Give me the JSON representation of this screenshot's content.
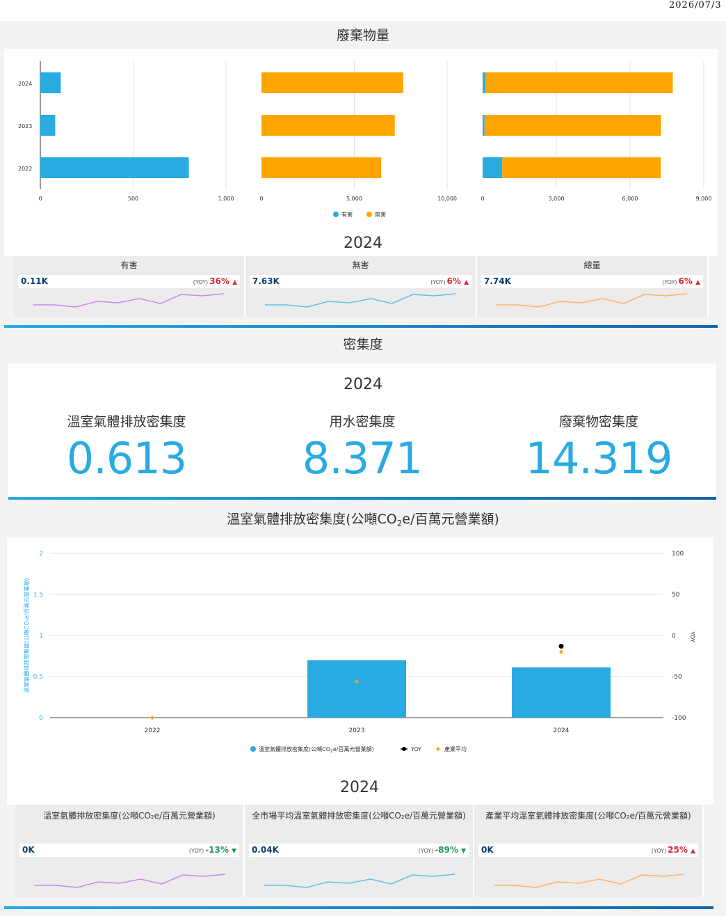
{
  "header": {
    "date": "2026/07/3"
  },
  "waste": {
    "title": "廢棄物量",
    "year": "2024",
    "legend": [
      {
        "name": "有害",
        "color": "#29abe2"
      },
      {
        "name": "無害",
        "color": "#ffa500"
      }
    ],
    "kpis": [
      {
        "title": "有害",
        "value": "0.11K",
        "yoy_label": "(YOY)",
        "yoy": "36%",
        "dir": "up",
        "arrow": "▲",
        "spark_color": "#c58af0"
      },
      {
        "title": "無害",
        "value": "7.63K",
        "yoy_label": "(YOY)",
        "yoy": "6%",
        "dir": "up",
        "arrow": "▲",
        "spark_color": "#5ec1ea"
      },
      {
        "title": "總量",
        "value": "7.74K",
        "yoy_label": "(YOY)",
        "yoy": "6%",
        "dir": "up",
        "arrow": "▲",
        "spark_color": "#ffb36b"
      }
    ]
  },
  "density": {
    "title": "密集度",
    "year": "2024",
    "items": [
      {
        "label": "溫室氣體排放密集度",
        "value": "0.613"
      },
      {
        "label": "用水密集度",
        "value": "8.371"
      },
      {
        "label": "廢棄物密集度",
        "value": "14.319"
      }
    ]
  },
  "ghg": {
    "title_pre": "溫室氣體排放密集度(公噸CO",
    "title_sub": "2",
    "title_post": "e/百萬元營業額)",
    "year": "2024",
    "legend": {
      "bar_pre": "溫室氣體排放密集度(公噸CO",
      "bar_sub": "2",
      "bar_post": "e/百萬元營業額)",
      "yoy": "YOY",
      "avg": "產業平均"
    },
    "kpis": [
      {
        "title": "溫室氣體排放密集度(公噸CO₂e/百萬元營業額)",
        "value": "0K",
        "yoy_label": "(YOY)",
        "yoy": "-13%",
        "dir": "down",
        "arrow": "▼",
        "spark_color": "#c58af0"
      },
      {
        "title": "全市場平均溫室氣體排放密集度(公噸CO₂e/百萬元營業額)",
        "value": "0.04K",
        "yoy_label": "(YOY)",
        "yoy": "-89%",
        "dir": "down",
        "arrow": "▼",
        "spark_color": "#5ec1ea"
      },
      {
        "title": "產業平均溫室氣體排放密集度(公噸CO₂e/百萬元營業額)",
        "value": "0K",
        "yoy_label": "(YOY)",
        "yoy": "25%",
        "dir": "up",
        "arrow": "▲",
        "spark_color": "#ffb36b"
      }
    ]
  },
  "colors": {
    "blue": "#29abe2",
    "orange": "#ffa500",
    "navy": "#0b3b6b",
    "up": "#d9262f",
    "down": "#21965a"
  },
  "chart_data": [
    {
      "type": "bar",
      "orientation": "horizontal",
      "name": "有害",
      "categories": [
        "2022",
        "2023",
        "2024"
      ],
      "values": [
        800,
        80,
        110
      ],
      "xlim": [
        0,
        1000
      ],
      "ticks": [
        "0",
        "500",
        "1,000"
      ],
      "color": "#29abe2"
    },
    {
      "type": "bar",
      "orientation": "horizontal",
      "name": "無害",
      "categories": [
        "2022",
        "2023",
        "2024"
      ],
      "values": [
        6450,
        7180,
        7630
      ],
      "xlim": [
        0,
        10000
      ],
      "ticks": [
        "0",
        "5,000",
        "10,000"
      ],
      "color": "#ffa500"
    },
    {
      "type": "bar",
      "orientation": "horizontal",
      "stacked": true,
      "categories": [
        "2022",
        "2023",
        "2024"
      ],
      "series": [
        {
          "name": "有害",
          "values": [
            800,
            80,
            110
          ],
          "color": "#29abe2"
        },
        {
          "name": "無害",
          "values": [
            6450,
            7180,
            7630
          ],
          "color": "#ffa500"
        }
      ],
      "xlim": [
        0,
        9000
      ],
      "ticks": [
        "0",
        "3,000",
        "6,000",
        "9,000"
      ]
    },
    {
      "type": "bar",
      "categories": [
        "2022",
        "2023",
        "2024"
      ],
      "series": [
        {
          "name": "溫室氣體排放密集度(公噸CO₂e/百萬元營業額)",
          "type": "bar",
          "values": [
            0,
            0.7,
            0.613
          ],
          "axis": "left",
          "color": "#29abe2"
        },
        {
          "name": "YOY",
          "type": "scatter",
          "values": [
            null,
            null,
            -13
          ],
          "axis": "right",
          "color": "#000000"
        },
        {
          "name": "產業平均",
          "type": "scatter",
          "values": [
            0,
            0.44,
            0.8
          ],
          "axis": "left",
          "color": "#ffa500"
        }
      ],
      "ylabel": "溫室氣體排放密集度(公噸CO₂e/百萬元營業額)",
      "ylabel_right": "YOY",
      "ylim": [
        0,
        2
      ],
      "yticks": [
        "0",
        "0.5",
        "1",
        "1.5",
        "2"
      ],
      "ylim_right": [
        -100,
        100
      ],
      "yticks_right": [
        "-100",
        "-50",
        "0",
        "50",
        "100"
      ],
      "legend_position": "bottom"
    }
  ],
  "sparklines": [
    [
      0.2,
      0.2,
      0.05,
      0.45,
      0.35,
      0.65,
      0.3,
      0.95,
      0.85,
      1.0
    ],
    [
      0.2,
      0.2,
      0.05,
      0.45,
      0.35,
      0.65,
      0.3,
      0.95,
      0.85,
      1.0
    ],
    [
      0.2,
      0.2,
      0.05,
      0.45,
      0.35,
      0.65,
      0.3,
      0.95,
      0.85,
      1.0
    ]
  ]
}
